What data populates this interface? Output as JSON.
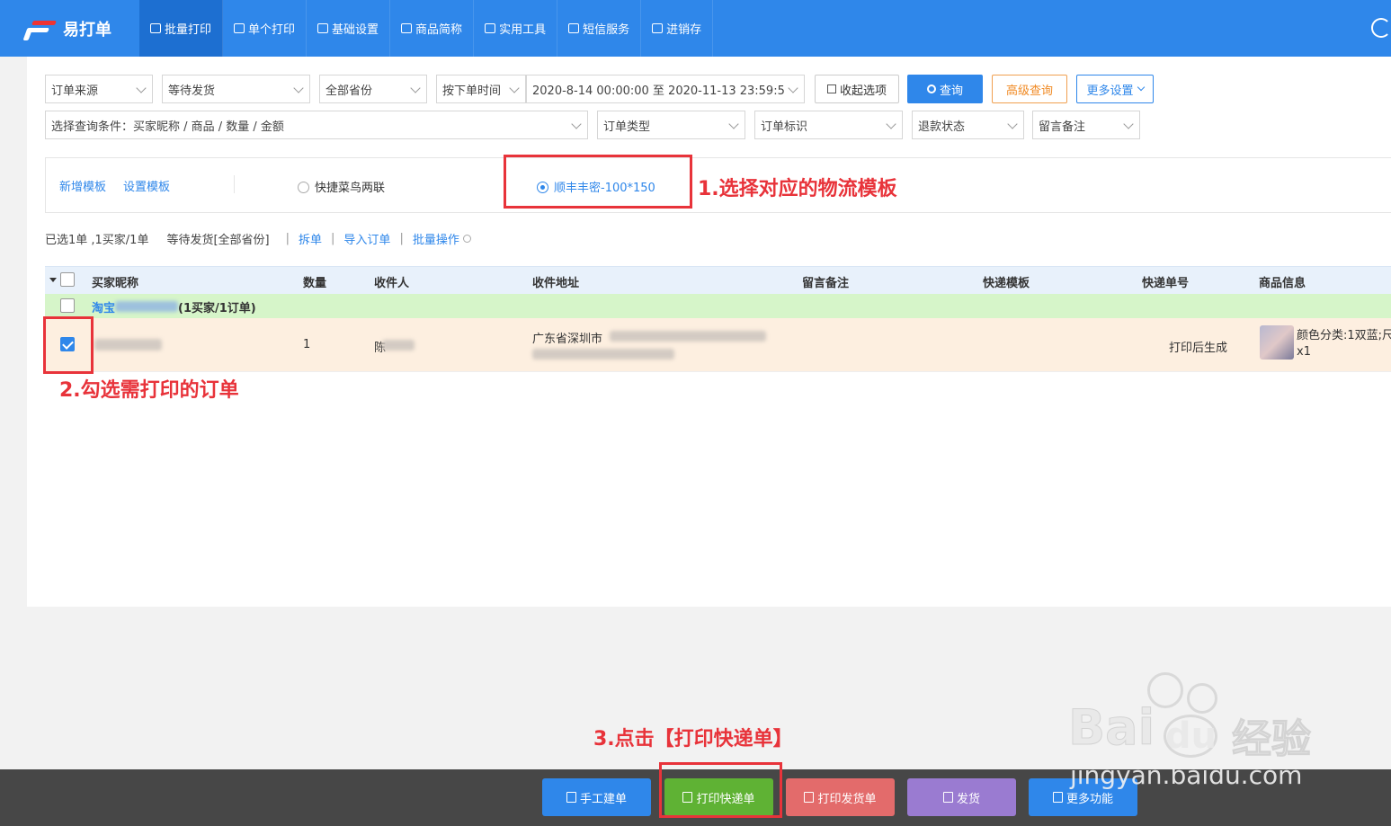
{
  "app": {
    "name": "易打单"
  },
  "nav": [
    {
      "label": "批量打印",
      "active": true
    },
    {
      "label": "单个打印"
    },
    {
      "label": "基础设置"
    },
    {
      "label": "商品简称"
    },
    {
      "label": "实用工具"
    },
    {
      "label": "短信服务"
    },
    {
      "label": "进销存"
    }
  ],
  "filters": {
    "order_source": "订单来源",
    "status": "等待发货",
    "province": "全部省份",
    "time_type": "按下单时间",
    "date_range": "2020-8-14 00:00:00 至 2020-11-13 23:59:5",
    "collapse": "收起选项",
    "query": "查询",
    "advanced": "高级查询",
    "more_settings": "更多设置",
    "query_condition": "选择查询条件：买家昵称 / 商品 / 数量 / 金额",
    "order_type": "订单类型",
    "order_flag": "订单标识",
    "refund_status": "退款状态",
    "memo": "留言备注"
  },
  "templates": {
    "add": "新增模板",
    "settings": "设置模板",
    "options": [
      {
        "label": "快捷菜鸟两联",
        "selected": false
      },
      {
        "label": "顺丰丰密-100*150",
        "selected": true
      }
    ]
  },
  "annotations": {
    "step1": "1.选择对应的物流模板",
    "step2": "2.勾选需打印的订单",
    "step3": "3.点击【打印快递单】"
  },
  "status_line": {
    "selected": "已选1单 ,1买家/1单",
    "waiting": "等待发货[全部省份]",
    "split": "拆单",
    "import": "导入订单",
    "batch": "批量操作"
  },
  "table": {
    "headers": [
      "买家昵称",
      "数量",
      "收件人",
      "收件地址",
      "留言备注",
      "快递模板",
      "快递单号",
      "商品信息"
    ],
    "group": {
      "prefix": "淘宝",
      "suffix": "(1买家/1订单)"
    },
    "row": {
      "qty": "1",
      "recipient_prefix": "陈",
      "address": "广东省深圳市",
      "tracking": "打印后生成",
      "product_info": "颜色分类:1双蓝;尺",
      "product_qty": "x1"
    }
  },
  "bottom_buttons": [
    {
      "label": "手工建单",
      "color": "#2f87ea"
    },
    {
      "label": "打印快递单",
      "color": "#5fb234"
    },
    {
      "label": "打印发货单",
      "color": "#e36b6b"
    },
    {
      "label": "发货",
      "color": "#9a7bd1"
    },
    {
      "label": "更多功能",
      "color": "#2f87ea"
    }
  ],
  "watermark": {
    "brand": "Bai",
    "brand2": "du",
    "cn": "经验",
    "url": "jingyan.baidu.com"
  }
}
